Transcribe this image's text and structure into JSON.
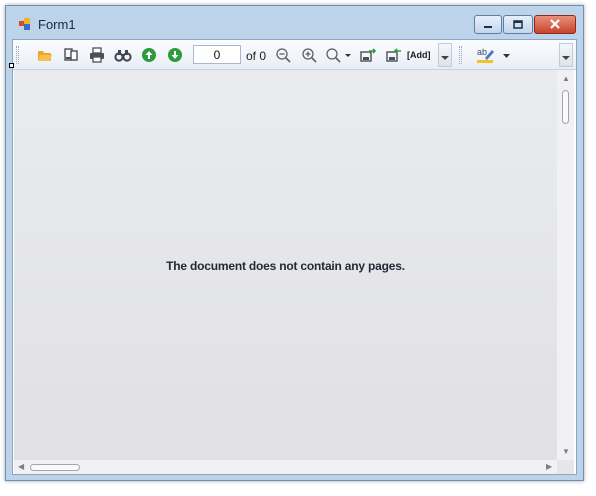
{
  "window": {
    "title": "Form1",
    "buttons": [
      "minimize",
      "maximize",
      "close"
    ]
  },
  "toolbar": {
    "page_input_value": "0",
    "page_count_label": "of 0",
    "add_label": "[Add]",
    "icons": [
      "open-icon",
      "page-setup-icon",
      "print-icon",
      "find-icon",
      "previous-page-icon",
      "next-page-icon",
      "zoom-out-icon",
      "zoom-in-icon",
      "zoom-icon",
      "export-icon",
      "send-icon",
      "highlight-icon"
    ]
  },
  "viewer": {
    "empty_message": "The document does not contain any pages."
  },
  "colors": {
    "titlebar": "#bcd3ea",
    "close_button": "#c7442c",
    "nav_green": "#2e9a3c",
    "folder_yellow": "#e9a92a"
  }
}
